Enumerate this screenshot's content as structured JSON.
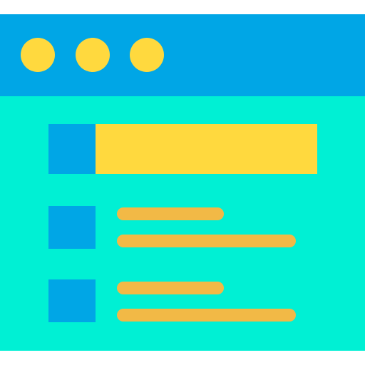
{
  "colors": {
    "titlebar": "#00a6e6",
    "content": "#00f0d4",
    "dot": "#ffd93e",
    "square": "#00a6e6",
    "header_fill": "#ffd93e",
    "line": "#f2b946"
  },
  "window": {
    "titlebar_icons": [
      "window-dot-icon",
      "window-dot-icon",
      "window-dot-icon"
    ],
    "header_icon": "list-header-icon",
    "rows": [
      {
        "icon": "list-item-square-icon",
        "lines": 2
      },
      {
        "icon": "list-item-square-icon",
        "lines": 2
      }
    ]
  }
}
